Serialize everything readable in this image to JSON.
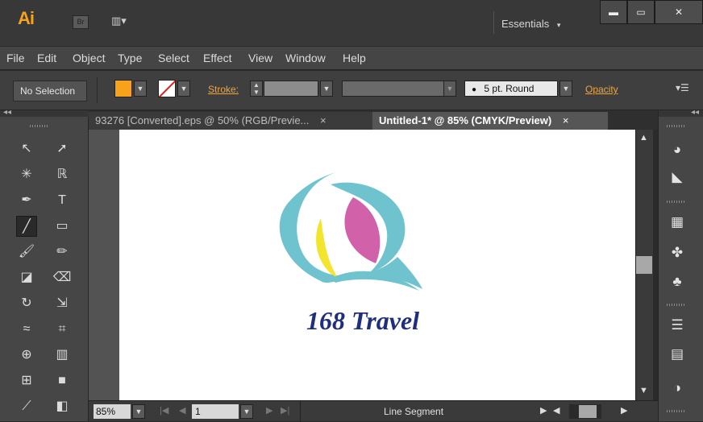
{
  "app": {
    "logo": "Ai",
    "bridge": "Br",
    "arrange_glyph": "▥▾",
    "workspace": "Essentials",
    "workspace_arrow": "▾",
    "min": "▬",
    "max": "▭",
    "close": "✕"
  },
  "menu": [
    "File",
    "Edit",
    "Object",
    "Type",
    "Select",
    "Effect",
    "View",
    "Window",
    "Help"
  ],
  "control": {
    "selection": "No Selection",
    "stroke_label": "Stroke:",
    "brush": "5 pt. Round",
    "opacity_label": "Opacity",
    "fill_color": "#f6a21b",
    "panel_menu_glyph": "▾☰"
  },
  "tabs": [
    {
      "label": "93276 [Converted].eps @ 50% (RGB/Previe...",
      "close": "×"
    },
    {
      "label": "Untitled-1* @ 85% (CMYK/Preview)",
      "close": "×"
    }
  ],
  "logo_art": {
    "text": "168 Travel",
    "colors": {
      "teal": "#6ec3cf",
      "magenta": "#d161a8",
      "yellow": "#f3e52e",
      "navy": "#1f2e7d"
    }
  },
  "status": {
    "zoom": "85%",
    "page": "1",
    "tool": "Line Segment"
  },
  "tools": [
    [
      "selection-tool-icon",
      "↖"
    ],
    [
      "direct-selection-tool-icon",
      "➚"
    ],
    [
      "magic-wand-tool-icon",
      "✳"
    ],
    [
      "lasso-tool-icon",
      "ℝ"
    ],
    [
      "pen-tool-icon",
      "✒"
    ],
    [
      "type-tool-icon",
      "T"
    ],
    [
      "line-segment-tool-icon",
      "╱"
    ],
    [
      "rectangle-tool-icon",
      "▭"
    ],
    [
      "paintbrush-tool-icon",
      "🖌"
    ],
    [
      "pencil-tool-icon",
      "✏"
    ],
    [
      "blob-brush-tool-icon",
      "◪"
    ],
    [
      "eraser-tool-icon",
      "⌫"
    ],
    [
      "rotate-tool-icon",
      "↻"
    ],
    [
      "scale-tool-icon",
      "⇲"
    ],
    [
      "width-tool-icon",
      "≈"
    ],
    [
      "free-transform-tool-icon",
      "⌗"
    ],
    [
      "shape-builder-tool-icon",
      "⊕"
    ],
    [
      "column-graph-tool-icon",
      "▥"
    ],
    [
      "mesh-tool-icon",
      "⊞"
    ],
    [
      "gradient-tool-icon",
      "■"
    ],
    [
      "eyedropper-tool-icon",
      "⟋"
    ],
    [
      "blend-tool-icon",
      "◧"
    ]
  ],
  "panels": [
    [
      "color-panel-icon",
      "◕"
    ],
    [
      "color-guide-panel-icon",
      "◣"
    ],
    [
      "swatches-panel-icon",
      "▦"
    ],
    [
      "brushes-panel-icon",
      "✤"
    ],
    [
      "symbols-panel-icon",
      "♣"
    ],
    [
      "stroke-panel-icon",
      "☰"
    ],
    [
      "gradient-panel-icon",
      "▤"
    ],
    [
      "transparency-panel-icon",
      "◑"
    ]
  ]
}
